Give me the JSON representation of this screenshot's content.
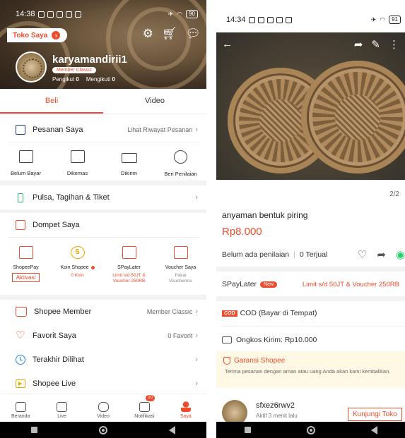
{
  "left": {
    "status": {
      "time": "14:38",
      "battery": "90"
    },
    "header": {
      "toko_saya": "Toko Saya"
    },
    "profile": {
      "username": "karyamandirii1",
      "member_badge": "Member Classic",
      "pengikut_label": "Pengikut",
      "pengikut_value": "0",
      "mengikuti_label": "Mengikuti",
      "mengikuti_value": "0"
    },
    "tabs": [
      {
        "label": "Beli"
      },
      {
        "label": "Video"
      }
    ],
    "orders": {
      "title": "Pesanan Saya",
      "history_link": "Lihat Riwayat Pesanan",
      "items": [
        {
          "label": "Belum Bayar"
        },
        {
          "label": "Dikemas"
        },
        {
          "label": "Dikirim"
        },
        {
          "label": "Beri Penilaian"
        }
      ]
    },
    "pulsa": {
      "label": "Pulsa, Tagihan & Tiket"
    },
    "wallet": {
      "title": "Dompet Saya",
      "items": [
        {
          "label": "ShopeePay",
          "sub": "Aktivasi"
        },
        {
          "label": "Koin Shopee",
          "sub": "0 Koin"
        },
        {
          "label": "SPayLater",
          "sub": "Limit s/d 50JT & Voucher 250RB"
        },
        {
          "label": "Voucher Saya",
          "sub": "Pakai Vouchermu"
        }
      ]
    },
    "menu": {
      "member": {
        "label": "Shopee Member",
        "right": "Member Classic"
      },
      "favorit": {
        "label": "Favorit Saya",
        "right": "0 Favorit"
      },
      "terakhir": {
        "label": "Terakhir Dilihat"
      },
      "live": {
        "label": "Shopee Live"
      }
    },
    "nav": [
      {
        "label": "Beranda"
      },
      {
        "label": "Live"
      },
      {
        "label": "Video"
      },
      {
        "label": "Notifikasi",
        "badge": "20"
      },
      {
        "label": "Saya"
      }
    ]
  },
  "right": {
    "status": {
      "time": "14:34",
      "battery": "91"
    },
    "pager": "2/2",
    "product": {
      "name": "anyaman bentuk piring",
      "price": "Rp8.000",
      "rating": "Belum ada penilaian",
      "sold": "0 Terjual"
    },
    "spaylater": {
      "label": "SPayLater",
      "badge": "New",
      "limit": "Limit s/d 50JT & Voucher 250RB"
    },
    "cod": {
      "badge": "COD",
      "label": "COD (Bayar di Tempat)"
    },
    "ongkos": {
      "label": "Ongkos Kirim: Rp10.000"
    },
    "garansi": {
      "title": "Garansi Shopee",
      "desc": "Terima pesanan dengan aman atau uang Anda akan kami kembalikan."
    },
    "seller": {
      "name": "sfxez6rwv2",
      "sub": "Aktif 3 menit lalu",
      "button": "Kunjungi Toko"
    }
  },
  "colors": {
    "accent": "#ee4d2d",
    "coin": "#f0a500",
    "link_blue": "#1e88e5",
    "whatsapp": "#25d366"
  },
  "icons": {
    "left_header": [
      "settings-icon",
      "cart-icon",
      "chat-icon"
    ],
    "right_photo": [
      "back-arrow-icon",
      "share-icon",
      "edit-icon",
      "more-icon"
    ]
  }
}
